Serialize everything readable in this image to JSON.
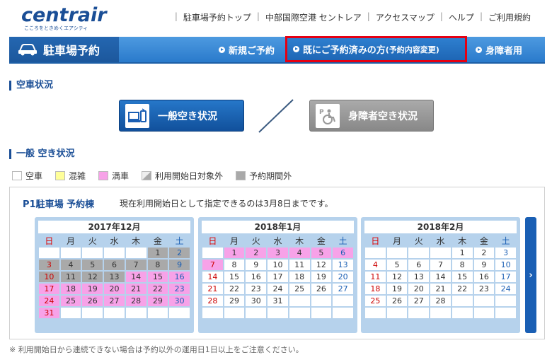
{
  "header": {
    "logo": "centrair",
    "logo_sub": "こころをときめくエアシティ",
    "nav": [
      "駐車場予約トップ",
      "中部国際空港 セントレア",
      "アクセスマップ",
      "ヘルプ",
      "ご利用規約"
    ]
  },
  "navbar": {
    "title": "駐車場予約",
    "links": [
      "新規ご予約",
      "既にご予約済みの方",
      "(予約内容変更)",
      "身障者用"
    ]
  },
  "section1": "空車状況",
  "buttons": {
    "general": "一般空き状況",
    "disabled": "身障者空き状況"
  },
  "section2": "一般 空き状況",
  "legend": [
    "空車",
    "混雑",
    "満車",
    "利用開始日対象外",
    "予約期間外"
  ],
  "legend_colors": {
    "empty": "#ffffff",
    "busy": "#ffff99",
    "full": "#f7a2e8",
    "outside": "#a9a9a9"
  },
  "panel": {
    "title": "P1駐車場 予約棟",
    "note": "現在利用開始日として指定できるのは3月8日までです。"
  },
  "weekdays": [
    "日",
    "月",
    "火",
    "水",
    "木",
    "金",
    "土"
  ],
  "calendars": [
    {
      "month": "2017年12月",
      "days": 31,
      "offset": 5,
      "full_from": 14,
      "na_until": 13
    },
    {
      "month": "2018年1月",
      "days": 31,
      "offset": 1,
      "full_from": 1,
      "full_until": 7
    },
    {
      "month": "2018年2月",
      "days": 28,
      "offset": 4
    }
  ],
  "next_label": "›",
  "footer": "※ 利用開始日から連続できない場合は予約以外の運用日1日以上をご注意ください。"
}
